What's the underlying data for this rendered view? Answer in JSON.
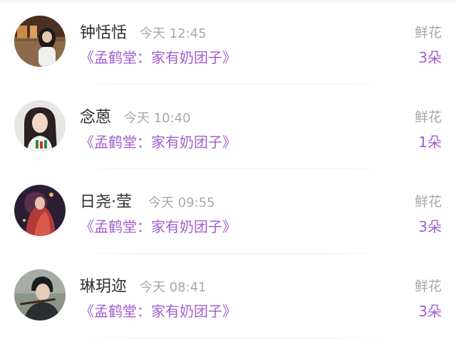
{
  "gifts": [
    {
      "name": "钟恬恬",
      "time": "今天 12:45",
      "work": "《孟鹤堂：家有奶团子》",
      "gift_type": "鲜花",
      "count": "3朵",
      "avatar_icon": "avatar-photo-woman-dark-hair-train"
    },
    {
      "name": "念蒽",
      "time": "今天 10:40",
      "work": "《孟鹤堂：家有奶团子》",
      "gift_type": "鲜花",
      "count": "1朵",
      "avatar_icon": "avatar-photo-woman-long-hair"
    },
    {
      "name": "日尧·莹",
      "time": "今天 09:55",
      "work": "《孟鹤堂：家有奶团子》",
      "gift_type": "鲜花",
      "count": "3朵",
      "avatar_icon": "avatar-photo-red-robed-figure"
    },
    {
      "name": "琳玥迩",
      "time": "今天 08:41",
      "work": "《孟鹤堂：家有奶团子》",
      "gift_type": "鲜花",
      "count": "3朵",
      "avatar_icon": "avatar-photo-man-playing-flute"
    }
  ],
  "colors": {
    "accent_purple": "#a25fd0",
    "name_text": "#2f2f2f",
    "muted_text": "#a8a8a8"
  }
}
